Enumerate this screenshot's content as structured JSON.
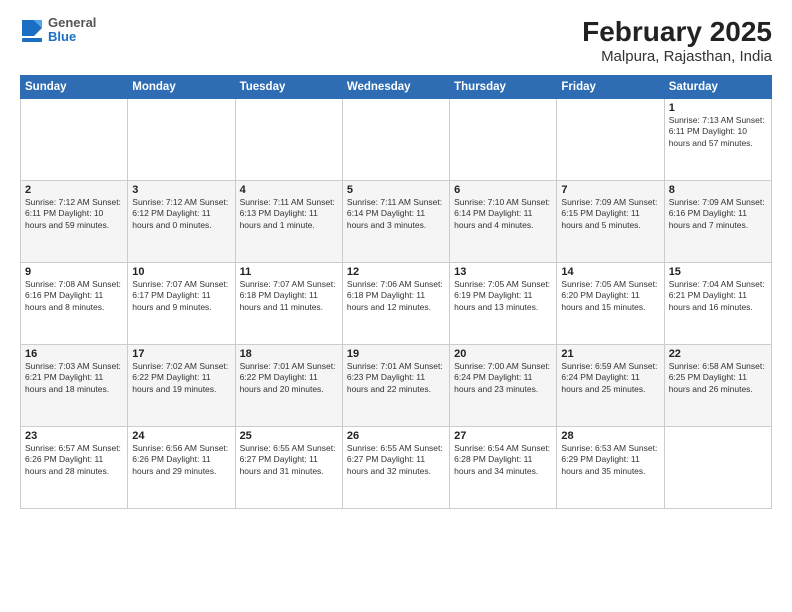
{
  "header": {
    "logo": {
      "general": "General",
      "blue": "Blue"
    },
    "title": "February 2025",
    "subtitle": "Malpura, Rajasthan, India"
  },
  "weekdays": [
    "Sunday",
    "Monday",
    "Tuesday",
    "Wednesday",
    "Thursday",
    "Friday",
    "Saturday"
  ],
  "weeks": [
    [
      {
        "day": "",
        "info": ""
      },
      {
        "day": "",
        "info": ""
      },
      {
        "day": "",
        "info": ""
      },
      {
        "day": "",
        "info": ""
      },
      {
        "day": "",
        "info": ""
      },
      {
        "day": "",
        "info": ""
      },
      {
        "day": "1",
        "info": "Sunrise: 7:13 AM\nSunset: 6:11 PM\nDaylight: 10 hours\nand 57 minutes."
      }
    ],
    [
      {
        "day": "2",
        "info": "Sunrise: 7:12 AM\nSunset: 6:11 PM\nDaylight: 10 hours\nand 59 minutes."
      },
      {
        "day": "3",
        "info": "Sunrise: 7:12 AM\nSunset: 6:12 PM\nDaylight: 11 hours\nand 0 minutes."
      },
      {
        "day": "4",
        "info": "Sunrise: 7:11 AM\nSunset: 6:13 PM\nDaylight: 11 hours\nand 1 minute."
      },
      {
        "day": "5",
        "info": "Sunrise: 7:11 AM\nSunset: 6:14 PM\nDaylight: 11 hours\nand 3 minutes."
      },
      {
        "day": "6",
        "info": "Sunrise: 7:10 AM\nSunset: 6:14 PM\nDaylight: 11 hours\nand 4 minutes."
      },
      {
        "day": "7",
        "info": "Sunrise: 7:09 AM\nSunset: 6:15 PM\nDaylight: 11 hours\nand 5 minutes."
      },
      {
        "day": "8",
        "info": "Sunrise: 7:09 AM\nSunset: 6:16 PM\nDaylight: 11 hours\nand 7 minutes."
      }
    ],
    [
      {
        "day": "9",
        "info": "Sunrise: 7:08 AM\nSunset: 6:16 PM\nDaylight: 11 hours\nand 8 minutes."
      },
      {
        "day": "10",
        "info": "Sunrise: 7:07 AM\nSunset: 6:17 PM\nDaylight: 11 hours\nand 9 minutes."
      },
      {
        "day": "11",
        "info": "Sunrise: 7:07 AM\nSunset: 6:18 PM\nDaylight: 11 hours\nand 11 minutes."
      },
      {
        "day": "12",
        "info": "Sunrise: 7:06 AM\nSunset: 6:18 PM\nDaylight: 11 hours\nand 12 minutes."
      },
      {
        "day": "13",
        "info": "Sunrise: 7:05 AM\nSunset: 6:19 PM\nDaylight: 11 hours\nand 13 minutes."
      },
      {
        "day": "14",
        "info": "Sunrise: 7:05 AM\nSunset: 6:20 PM\nDaylight: 11 hours\nand 15 minutes."
      },
      {
        "day": "15",
        "info": "Sunrise: 7:04 AM\nSunset: 6:21 PM\nDaylight: 11 hours\nand 16 minutes."
      }
    ],
    [
      {
        "day": "16",
        "info": "Sunrise: 7:03 AM\nSunset: 6:21 PM\nDaylight: 11 hours\nand 18 minutes."
      },
      {
        "day": "17",
        "info": "Sunrise: 7:02 AM\nSunset: 6:22 PM\nDaylight: 11 hours\nand 19 minutes."
      },
      {
        "day": "18",
        "info": "Sunrise: 7:01 AM\nSunset: 6:22 PM\nDaylight: 11 hours\nand 20 minutes."
      },
      {
        "day": "19",
        "info": "Sunrise: 7:01 AM\nSunset: 6:23 PM\nDaylight: 11 hours\nand 22 minutes."
      },
      {
        "day": "20",
        "info": "Sunrise: 7:00 AM\nSunset: 6:24 PM\nDaylight: 11 hours\nand 23 minutes."
      },
      {
        "day": "21",
        "info": "Sunrise: 6:59 AM\nSunset: 6:24 PM\nDaylight: 11 hours\nand 25 minutes."
      },
      {
        "day": "22",
        "info": "Sunrise: 6:58 AM\nSunset: 6:25 PM\nDaylight: 11 hours\nand 26 minutes."
      }
    ],
    [
      {
        "day": "23",
        "info": "Sunrise: 6:57 AM\nSunset: 6:26 PM\nDaylight: 11 hours\nand 28 minutes."
      },
      {
        "day": "24",
        "info": "Sunrise: 6:56 AM\nSunset: 6:26 PM\nDaylight: 11 hours\nand 29 minutes."
      },
      {
        "day": "25",
        "info": "Sunrise: 6:55 AM\nSunset: 6:27 PM\nDaylight: 11 hours\nand 31 minutes."
      },
      {
        "day": "26",
        "info": "Sunrise: 6:55 AM\nSunset: 6:27 PM\nDaylight: 11 hours\nand 32 minutes."
      },
      {
        "day": "27",
        "info": "Sunrise: 6:54 AM\nSunset: 6:28 PM\nDaylight: 11 hours\nand 34 minutes."
      },
      {
        "day": "28",
        "info": "Sunrise: 6:53 AM\nSunset: 6:29 PM\nDaylight: 11 hours\nand 35 minutes."
      },
      {
        "day": "",
        "info": ""
      }
    ]
  ]
}
